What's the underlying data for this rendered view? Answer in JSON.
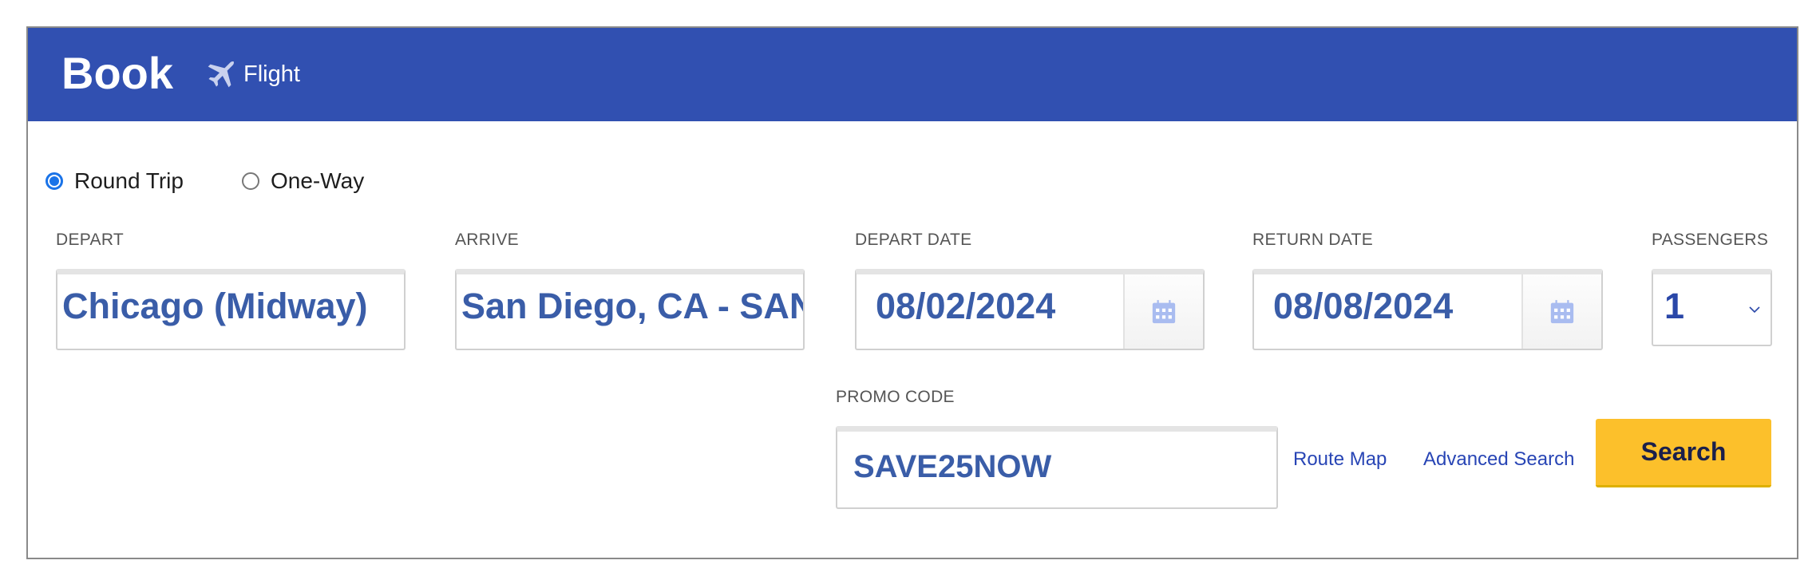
{
  "header": {
    "title": "Book",
    "tab_label": "Flight",
    "tab_icon": "airplane-icon",
    "background": "#3150b1"
  },
  "trip_type": {
    "options": [
      {
        "label": "Round Trip",
        "selected": true
      },
      {
        "label": "One-Way",
        "selected": false
      }
    ]
  },
  "fields": {
    "depart": {
      "label": "DEPART",
      "value": "Chicago (Midway)"
    },
    "arrive": {
      "label": "ARRIVE",
      "value": "San Diego, CA - SAN"
    },
    "depart_date": {
      "label": "DEPART DATE",
      "value": "08/02/2024",
      "icon": "calendar-icon"
    },
    "return_date": {
      "label": "RETURN DATE",
      "value": "08/08/2024",
      "icon": "calendar-icon"
    },
    "passengers": {
      "label": "PASSENGERS",
      "value": "1",
      "icon": "chevron-down-icon"
    },
    "promo": {
      "label": "PROMO CODE",
      "value": "SAVE25NOW"
    }
  },
  "links": {
    "route_map": "Route Map",
    "advanced_search": "Advanced Search"
  },
  "search_button": {
    "label": "Search",
    "color": "#fcc02b"
  }
}
